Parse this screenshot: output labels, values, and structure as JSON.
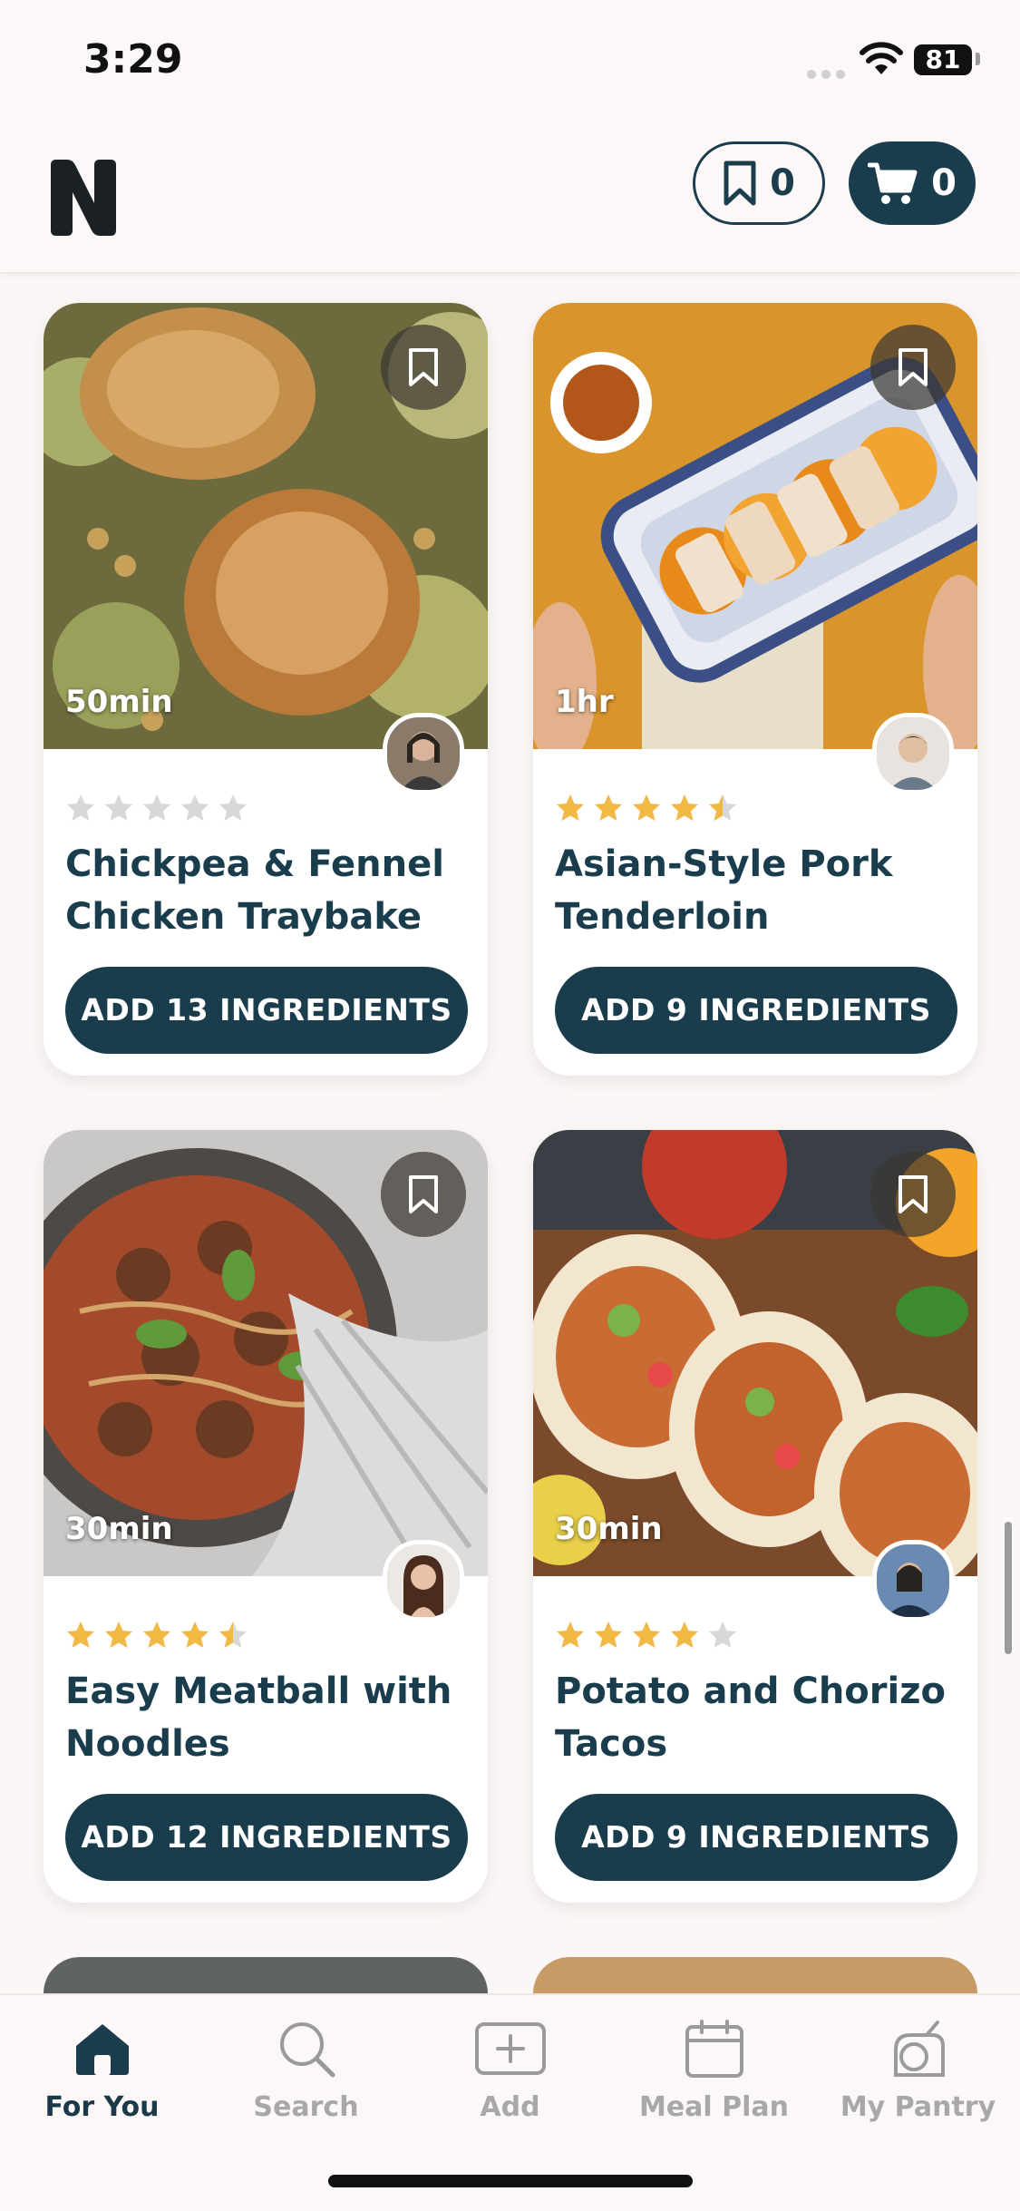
{
  "status_bar": {
    "time": "3:29",
    "battery": "81"
  },
  "header": {
    "saved_count": "0",
    "cart_count": "0"
  },
  "recipes": [
    {
      "time": "50min",
      "title": "Chickpea & Fennel Chicken Traybake",
      "button": "ADD 13 INGREDIENTS",
      "rating": 0
    },
    {
      "time": "1hr",
      "title": "Asian-Style Pork Tenderloin",
      "button": "ADD 9 INGREDIENTS",
      "rating": 4.5
    },
    {
      "time": "30min",
      "title": "Easy Meatball with Noodles",
      "button": "ADD 12 INGREDIENTS",
      "rating": 4.5
    },
    {
      "time": "30min",
      "title": "Potato and Chorizo Tacos",
      "button": "ADD 9 INGREDIENTS",
      "rating": 4
    }
  ],
  "tabs": [
    {
      "label": "For You",
      "icon": "home-icon",
      "active": true
    },
    {
      "label": "Search",
      "icon": "search-icon",
      "active": false
    },
    {
      "label": "Add",
      "icon": "add-icon",
      "active": false
    },
    {
      "label": "Meal Plan",
      "icon": "calendar-icon",
      "active": false
    },
    {
      "label": "My Pantry",
      "icon": "pantry-icon",
      "active": false
    }
  ],
  "colors": {
    "brand_dark": "#1a3d4e",
    "star": "#f2b844",
    "star_empty": "#d8d8d8",
    "background": "#fbf7f6"
  }
}
